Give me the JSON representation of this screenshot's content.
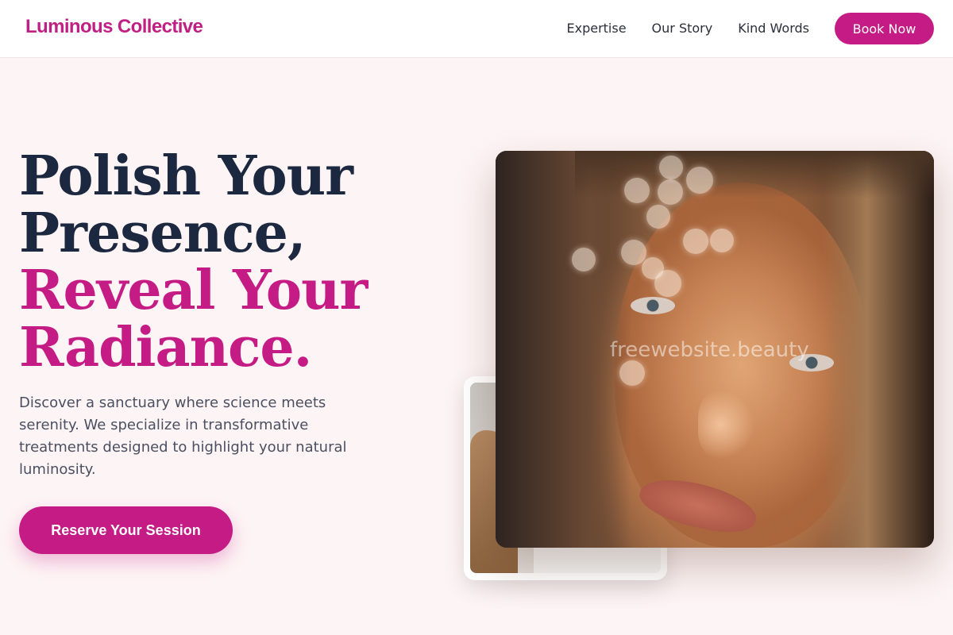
{
  "header": {
    "logo": "Luminous Collective",
    "nav": [
      "Expertise",
      "Our Story",
      "Kind Words"
    ],
    "book_label": "Book Now"
  },
  "hero": {
    "title_line1": "Polish Your",
    "title_line2": "Presence,",
    "title_line3": "Reveal Your",
    "title_line4": "Radiance.",
    "description": "Discover a sanctuary where science meets serenity. We specialize in transformative treatments designed to highlight your natural luminosity.",
    "cta_label": "Reserve Your Session"
  },
  "media": {
    "watermark": "freewebsite.beauty"
  },
  "colors": {
    "brand": "#c51b84",
    "heading_dark": "#1c2840",
    "background": "#fdf4f5"
  }
}
